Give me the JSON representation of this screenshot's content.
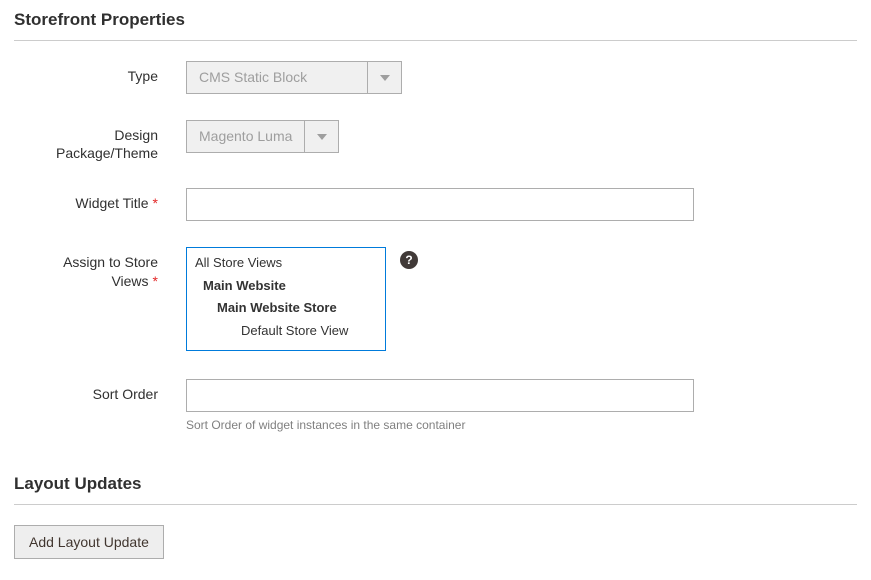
{
  "sections": {
    "storefront_title": "Storefront Properties",
    "layout_title": "Layout Updates"
  },
  "labels": {
    "type": "Type",
    "theme": "Design Package/Theme",
    "widget_title": "Widget Title",
    "store_views": "Assign to Store Views",
    "sort_order": "Sort Order"
  },
  "values": {
    "type": "CMS Static Block",
    "theme": "Magento Luma",
    "widget_title": "",
    "sort_order": ""
  },
  "store_views": {
    "options": [
      {
        "label": "All Store Views",
        "level": 0
      },
      {
        "label": "Main Website",
        "level": 1
      },
      {
        "label": "Main Website Store",
        "level": 2
      },
      {
        "label": "Default Store View",
        "level": 3
      }
    ]
  },
  "notes": {
    "sort_order": "Sort Order of widget instances in the same container"
  },
  "buttons": {
    "add_layout": "Add Layout Update"
  },
  "icons": {
    "help": "?"
  }
}
